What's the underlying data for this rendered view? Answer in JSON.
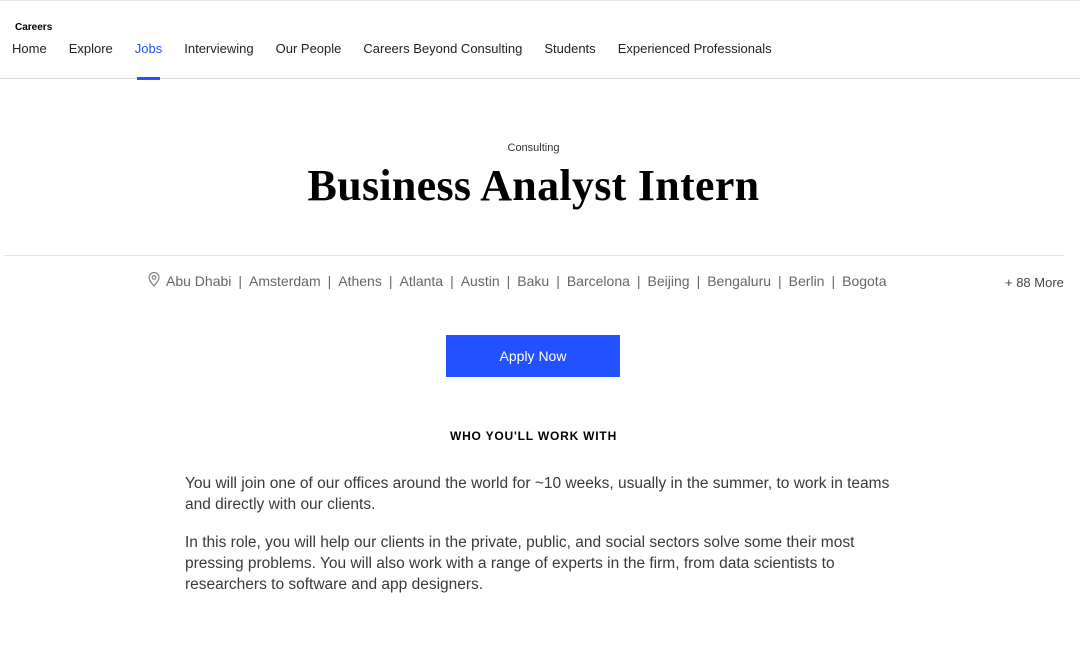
{
  "header": {
    "brand": "Careers",
    "nav": [
      {
        "label": "Home",
        "active": false
      },
      {
        "label": "Explore",
        "active": false
      },
      {
        "label": "Jobs",
        "active": true
      },
      {
        "label": "Interviewing",
        "active": false
      },
      {
        "label": "Our People",
        "active": false
      },
      {
        "label": "Careers Beyond Consulting",
        "active": false
      },
      {
        "label": "Students",
        "active": false
      },
      {
        "label": "Experienced Professionals",
        "active": false
      }
    ]
  },
  "job": {
    "category": "Consulting",
    "title": "Business Analyst Intern",
    "locations": [
      "Abu Dhabi",
      "Amsterdam",
      "Athens",
      "Atlanta",
      "Austin",
      "Baku",
      "Barcelona",
      "Beijing",
      "Bengaluru",
      "Berlin",
      "Bogota"
    ],
    "location_separator": "|",
    "location_icon": "map-pin-icon",
    "more_locations": "+ 88 More",
    "apply_label": "Apply Now"
  },
  "section": {
    "heading": "WHO YOU'LL WORK WITH",
    "paragraphs": [
      "You will join one of our offices around the world for ~10 weeks, usually in the summer, to work in teams and directly with our clients.",
      "In this role, you will help our clients in the private, public, and social sectors solve some their most pressing problems. You will also work with a range of experts in the firm, from data scientists to researchers to software and app designers."
    ]
  },
  "colors": {
    "accent": "#2251ff",
    "text": "#000000",
    "muted": "#666666"
  }
}
